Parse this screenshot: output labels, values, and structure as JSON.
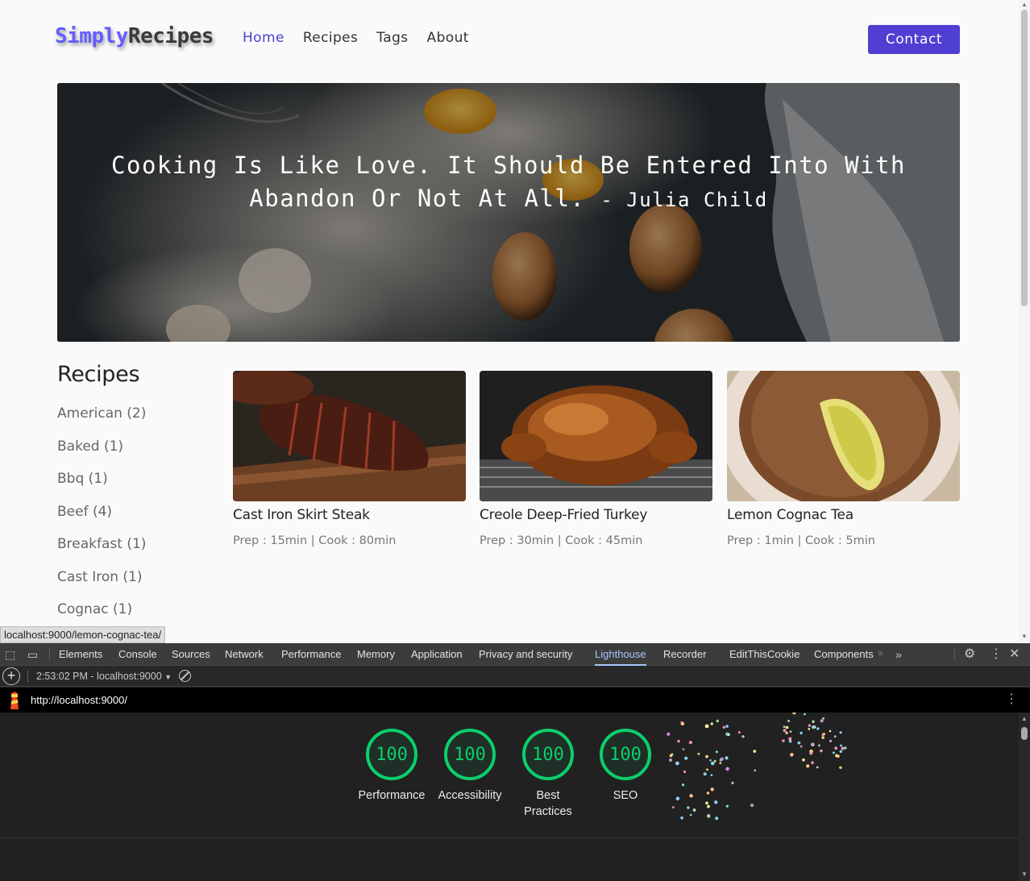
{
  "navbar": {
    "logo_part1": "Simply",
    "logo_part2": "Recipes",
    "links": [
      "Home",
      "Recipes",
      "Tags",
      "About"
    ],
    "active_link": "Home",
    "contact_label": "Contact"
  },
  "hero": {
    "quote": "Cooking Is Like Love. It Should Be Entered Into With Abandon Or Not At All.",
    "author": "- Julia Child"
  },
  "sidebar": {
    "title": "Recipes",
    "tags": [
      "American (2)",
      "Baked (1)",
      "Bbq (1)",
      "Beef (4)",
      "Breakfast (1)",
      "Cast Iron (1)",
      "Cognac (1)"
    ]
  },
  "recipes": [
    {
      "title": "Cast Iron Skirt Steak",
      "meta": "Prep : 15min | Cook : 80min"
    },
    {
      "title": "Creole Deep-Fried Turkey",
      "meta": "Prep : 30min | Cook : 45min"
    },
    {
      "title": "Lemon Cognac Tea",
      "meta": "Prep : 1min | Cook : 5min"
    }
  ],
  "status_bar": {
    "url": "localhost:9000/lemon-cognac-tea/"
  },
  "devtools": {
    "tabs": [
      "Elements",
      "Console",
      "Sources",
      "Network",
      "Performance",
      "Memory",
      "Application",
      "Privacy and security",
      "Lighthouse",
      "Recorder",
      "EditThisCookie",
      "Components"
    ],
    "active_tab": "Lighthouse",
    "report_select": "2:53:02 PM - localhost:9000",
    "lighthouse_url": "http://localhost:9000/",
    "scores": [
      {
        "label": "Performance",
        "value": "100"
      },
      {
        "label": "Accessibility",
        "value": "100"
      },
      {
        "label": "Best Practices",
        "value": "100"
      },
      {
        "label": "SEO",
        "value": "100"
      }
    ],
    "score_color": "#0cce6b"
  },
  "colors": {
    "brand": "#645cff",
    "contact_button": "#4f3fd3",
    "active_tab": "#a8c7fa"
  }
}
